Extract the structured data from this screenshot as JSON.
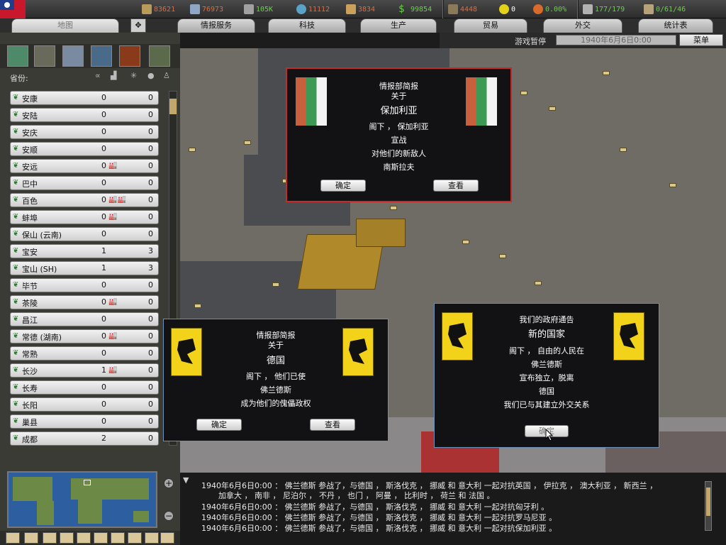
{
  "resources": [
    {
      "icon": "energy-icon",
      "value": "83621",
      "color": "#e06a3e"
    },
    {
      "icon": "metal-icon",
      "value": "76973",
      "color": "#e06a3e"
    },
    {
      "icon": "rare-materials-icon",
      "value": "105K",
      "color": "#69d04a"
    },
    {
      "icon": "oil-icon",
      "value": "11112",
      "color": "#e06a3e"
    },
    {
      "icon": "supplies-icon",
      "value": "3834",
      "color": "#e06a3e"
    },
    {
      "icon": "money-icon",
      "value": "99854",
      "color": "#69d04a"
    }
  ],
  "stats": [
    {
      "icon": "manpower-icon",
      "value": "4448",
      "color": "#e06a3e"
    },
    {
      "icon": "nuclear-icon",
      "value": "0",
      "color": "#ffffff"
    },
    {
      "icon": "dissent-icon",
      "value": "0.00%",
      "color": "#69d04a"
    },
    {
      "icon": "transport-icon",
      "value": "177/179",
      "color": "#69d04a"
    },
    {
      "icon": "convoy-icon",
      "value": "0/61/46",
      "color": "#69d04a"
    }
  ],
  "tabs": [
    {
      "label": "地图"
    },
    {
      "label": "情报服务"
    },
    {
      "label": "科技"
    },
    {
      "label": "生产"
    },
    {
      "label": "贸易"
    },
    {
      "label": "外交"
    },
    {
      "label": "统计表"
    }
  ],
  "status": {
    "paused": "游戏暂停",
    "date": "1940年6月6日0:00",
    "menu": "菜单"
  },
  "province_header": "省份:",
  "provinces": [
    {
      "name": "安康",
      "v1": "0",
      "v2": "0",
      "building": ""
    },
    {
      "name": "安陆",
      "v1": "0",
      "v2": "0",
      "building": ""
    },
    {
      "name": "安庆",
      "v1": "0",
      "v2": "0",
      "building": ""
    },
    {
      "name": "安顺",
      "v1": "0",
      "v2": "0",
      "building": ""
    },
    {
      "name": "安远",
      "v1": "0",
      "v2": "0",
      "building": "🏭"
    },
    {
      "name": "巴中",
      "v1": "0",
      "v2": "0",
      "building": ""
    },
    {
      "name": "百色",
      "v1": "0",
      "v2": "0",
      "building": "🏭🏭"
    },
    {
      "name": "蚌埠",
      "v1": "0",
      "v2": "0",
      "building": "🏭"
    },
    {
      "name": "保山 (云南)",
      "v1": "0",
      "v2": "0",
      "building": ""
    },
    {
      "name": "宝安",
      "v1": "1",
      "v2": "3",
      "building": ""
    },
    {
      "name": "宝山 (SH)",
      "v1": "1",
      "v2": "3",
      "building": ""
    },
    {
      "name": "毕节",
      "v1": "0",
      "v2": "0",
      "building": ""
    },
    {
      "name": "茶陵",
      "v1": "0",
      "v2": "0",
      "building": "🏭"
    },
    {
      "name": "昌江",
      "v1": "0",
      "v2": "0",
      "building": ""
    },
    {
      "name": "常德 (湖南)",
      "v1": "0",
      "v2": "0",
      "building": "🏭"
    },
    {
      "name": "常熟",
      "v1": "0",
      "v2": "0",
      "building": ""
    },
    {
      "name": "长沙",
      "v1": "1",
      "v2": "0",
      "building": "🏭"
    },
    {
      "name": "长寿",
      "v1": "0",
      "v2": "0",
      "building": ""
    },
    {
      "name": "长阳",
      "v1": "0",
      "v2": "0",
      "building": ""
    },
    {
      "name": "巢县",
      "v1": "0",
      "v2": "0",
      "building": ""
    },
    {
      "name": "成都",
      "v1": "2",
      "v2": "0",
      "building": ""
    }
  ],
  "dialog_bulgaria": {
    "line1": "情报部简报",
    "line2": "关于",
    "line3": "保加利亚",
    "line4": "阁下 ， 保加利亚",
    "line5": "宣战",
    "line6": "对他们的新敌人",
    "line7": "南斯拉夫",
    "ok": "确定",
    "view": "查看"
  },
  "dialog_germany": {
    "line1": "情报部简报",
    "line2": "关于",
    "line3": "德国",
    "line4": "阁下 ， 他们已使",
    "line5": "佛兰德斯",
    "line6": "成为他们的傀儡政权",
    "ok": "确定",
    "view": "查看"
  },
  "dialog_newnation": {
    "line1": "我们的政府通告",
    "line2": "新的国家",
    "line3": "阁下 ， 自由的人民在",
    "line4": "佛兰德斯",
    "line5": "宣布独立，脱离",
    "line6": "德国",
    "line7": "我们已与其建立外交关系",
    "ok": "确定"
  },
  "log": {
    "l1": "1940年6月6日0:00  ： 佛兰德斯 参战了，与德国 ， 斯洛伐克 ， 挪威 和 意大利 一起对抗英国 ， 伊拉克 ， 澳大利亚 ， 新西兰 ，",
    "l2": "加拿大 ， 南非 ， 尼泊尔 ， 不丹 ， 也门 ， 阿曼 ， 比利时 ， 荷兰 和 法国 。",
    "l3": "1940年6月6日0:00  ： 佛兰德斯 参战了，与德国 ， 斯洛伐克 ， 挪威 和 意大利 一起对抗匈牙利 。",
    "l4": "1940年6月6日0:00  ： 佛兰德斯 参战了，与德国 ， 斯洛伐克 ， 挪威 和 意大利 一起对抗罗马尼亚 。",
    "l5": "1940年6月6日0:00  ： 佛兰德斯 参战了，与德国 ， 斯洛伐克 ， 挪威 和 意大利 一起对抗保加利亚 。"
  }
}
